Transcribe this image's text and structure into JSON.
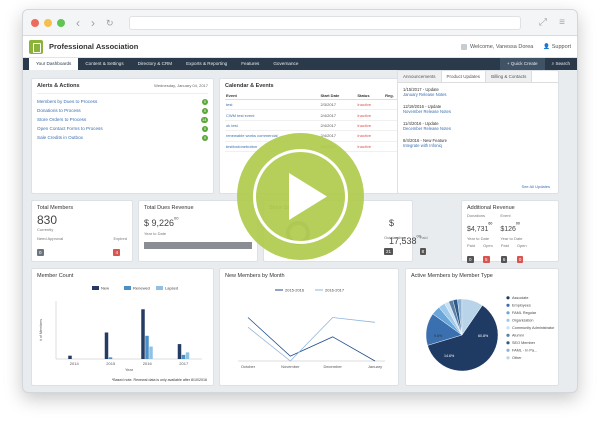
{
  "app": {
    "title": "Professional Association",
    "welcome": "Welcome, Vanessa Dorea",
    "support": "Support"
  },
  "menu": [
    {
      "label": "Your Dashboards",
      "active": true
    },
    {
      "label": "Content & Settings"
    },
    {
      "label": "Directory & CRM"
    },
    {
      "label": "Exports & Reporting"
    },
    {
      "label": "Features"
    },
    {
      "label": "Governance"
    }
  ],
  "menu_right": {
    "quick_create": "+ Quick Create",
    "search": "Search"
  },
  "alerts": {
    "title": "Alerts & Actions",
    "date": "Wednesday, January 04, 2017",
    "items": [
      {
        "label": "Members by Dues to Process",
        "count": "0"
      },
      {
        "label": "Donations to Process",
        "count": "0"
      },
      {
        "label": "Store Orders to Process",
        "count": "14"
      },
      {
        "label": "Open Contact Forms to Process",
        "count": "0"
      },
      {
        "label": "Sale Credits in Outbox",
        "count": "0"
      }
    ]
  },
  "calendar": {
    "title": "Calendar & Events",
    "headers": [
      "Event",
      "Start Date",
      "Status",
      "Reg."
    ],
    "rows": [
      {
        "event": "test",
        "date": "2/3/2017",
        "status": "Inactive"
      },
      {
        "event": "CWM test event",
        "date": "2/4/2017",
        "status": "Inactive"
      },
      {
        "event": "ok test",
        "date": "2/4/2017",
        "status": "Inactive"
      },
      {
        "event": "renewable works commercial",
        "date": "2/4/2017",
        "status": "Inactive"
      },
      {
        "event": "testfordonebutton",
        "date": "2/4/2017",
        "status": "Inactive"
      }
    ]
  },
  "updates": {
    "tabs": [
      "Announcements",
      "Product Updates",
      "Billing & Contacts"
    ],
    "items": [
      {
        "date": "1/15/2017 - Update",
        "link": "January Release Notes"
      },
      {
        "date": "12/19/2016 - Update",
        "link": "November Release Notes"
      },
      {
        "date": "11/4/2016 - Update",
        "link": "December Release Notes"
      },
      {
        "date": "8/4/2016 - New Feature",
        "link": "Integrate with Infoniq"
      }
    ],
    "see_all": "See All Updates"
  },
  "total_members": {
    "title": "Total Members",
    "value": "830",
    "sub": "Currently",
    "stats": [
      {
        "label": "Need Approval",
        "value": "0",
        "color": "#6c757d"
      },
      {
        "label": "Expired",
        "value": "4",
        "color": "#d9534f"
      }
    ]
  },
  "dues": {
    "title": "Total Dues Revenue",
    "value": "$ 9,226",
    "cents": "00",
    "sub": "Year to Date"
  },
  "store": {
    "title": "Store Sales",
    "value": "$ 17,538",
    "cents": "00",
    "stats": [
      {
        "label": "Outstanding",
        "value": "21",
        "color": "#555"
      },
      {
        "label": "Paid",
        "value": "8",
        "color": "#555"
      }
    ]
  },
  "additional": {
    "title": "Additional Revenue",
    "cols": [
      {
        "label": "Donations",
        "value": "$4,731",
        "cents": "60",
        "sub": "Year to Date"
      },
      {
        "label": "Event",
        "value": "$126",
        "cents": "00",
        "sub": "Year to Date"
      }
    ],
    "stats": [
      {
        "label": "Paid",
        "value": "0",
        "color": "#555"
      },
      {
        "label": "Open",
        "value": "5",
        "color": "#d9534f"
      },
      {
        "label": "Paid",
        "value": "6",
        "color": "#555"
      },
      {
        "label": "Open",
        "value": "0",
        "color": "#d9534f"
      }
    ]
  },
  "member_count": {
    "title": "Member Count",
    "note": "*Based note. Renewal data is only available after 8/10/2016",
    "chart_data": {
      "type": "bar",
      "categories": [
        "2014",
        "2015",
        "2016",
        "2017"
      ],
      "series": [
        {
          "name": "New",
          "values": [
            4,
            32,
            60,
            18
          ],
          "color": "#243b63"
        },
        {
          "name": "Renewed",
          "values": [
            0,
            2,
            28,
            5
          ],
          "color": "#4a90c8"
        },
        {
          "name": "Lapsed",
          "values": [
            0,
            0,
            15,
            8
          ],
          "color": "#8fc1e3"
        }
      ],
      "ylim": [
        0,
        70
      ],
      "xlabel": "Year",
      "ylabel": "# of Members"
    }
  },
  "new_members": {
    "title": "New Members by Month",
    "chart_data": {
      "type": "line",
      "categories": [
        "October",
        "November",
        "December",
        "January"
      ],
      "series": [
        {
          "name": "2015-2016",
          "values": [
            9,
            1,
            5,
            0
          ],
          "color": "#1f4e8c"
        },
        {
          "name": "2016-2017",
          "values": [
            7,
            0,
            9,
            8
          ],
          "color": "#8fb4dd"
        }
      ],
      "ylim": [
        0,
        12
      ]
    }
  },
  "active_members": {
    "title": "Active Members by Member Type",
    "chart_data": {
      "type": "pie",
      "labels": [
        "Associate",
        "Employees",
        "FAML Regular",
        "Organization",
        "Community Administrator",
        "Alumni",
        "SEO Member",
        "FAML - In Pa...",
        "Other"
      ],
      "values": [
        60.8,
        14.6,
        4,
        3,
        2,
        2,
        2,
        2,
        9.6
      ],
      "colors": [
        "#1f3a63",
        "#3a6fb0",
        "#6aa6d9",
        "#9ec9ea",
        "#c6e0f4",
        "#5c7fa3",
        "#2d5a88",
        "#8db3d4",
        "#b9d3e9"
      ],
      "data_labels": [
        "60.8%",
        "14.6%",
        "9.6%"
      ]
    }
  },
  "colors": {
    "accent": "#8ab33a",
    "menubar": "#2b3a4a",
    "play": "#b0cb4d"
  }
}
